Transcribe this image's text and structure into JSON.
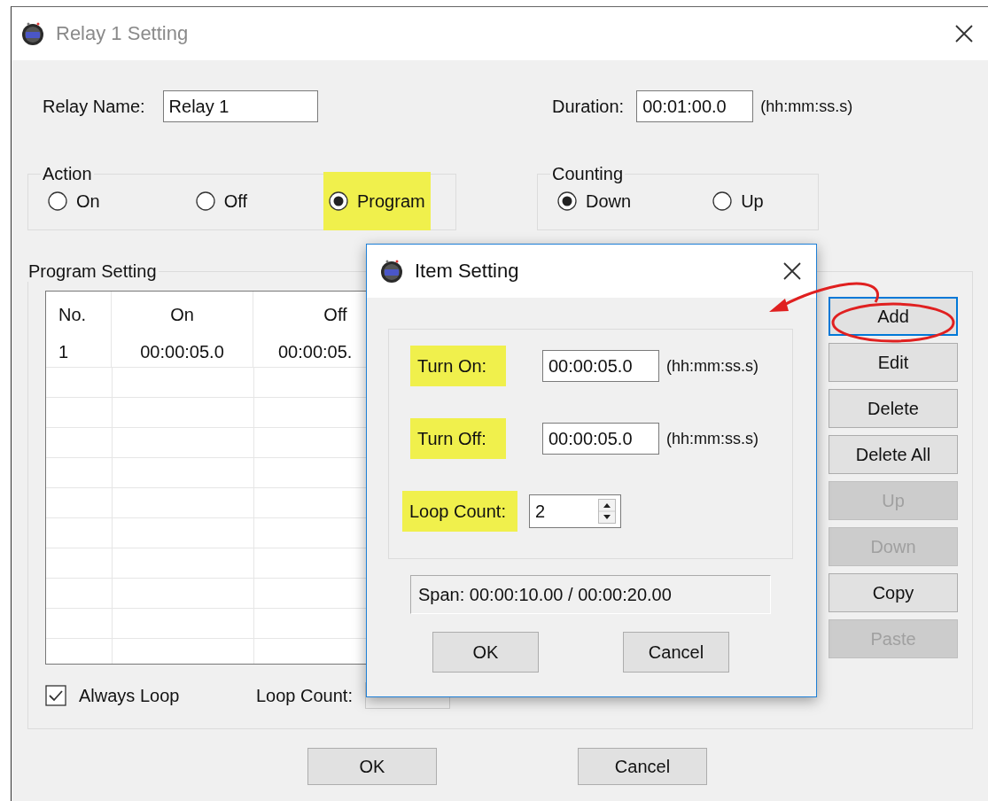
{
  "window": {
    "title": "Relay 1 Setting"
  },
  "relay_name": {
    "label": "Relay Name:",
    "value": "Relay 1"
  },
  "duration": {
    "label": "Duration:",
    "value": "00:01:00.0",
    "hint": "(hh:mm:ss.s)"
  },
  "action": {
    "title": "Action",
    "options": [
      {
        "label": "On",
        "selected": false,
        "highlighted": false
      },
      {
        "label": "Off",
        "selected": false,
        "highlighted": false
      },
      {
        "label": "Program",
        "selected": true,
        "highlighted": true
      }
    ]
  },
  "counting": {
    "title": "Counting",
    "options": [
      {
        "label": "Down",
        "selected": true
      },
      {
        "label": "Up",
        "selected": false
      }
    ]
  },
  "program_setting": {
    "title": "Program Setting",
    "table": {
      "columns": [
        "No.",
        "On",
        "Off"
      ],
      "rows": [
        [
          "1",
          "00:00:05.0",
          "00:00:05."
        ]
      ]
    },
    "buttons": [
      {
        "label": "Add",
        "disabled": false,
        "focused": true,
        "circled": true
      },
      {
        "label": "Edit",
        "disabled": false,
        "focused": false,
        "circled": false
      },
      {
        "label": "Delete",
        "disabled": false,
        "focused": false,
        "circled": false
      },
      {
        "label": "Delete All",
        "disabled": false,
        "focused": false,
        "circled": false
      },
      {
        "label": "Up",
        "disabled": true,
        "focused": false,
        "circled": false
      },
      {
        "label": "Down",
        "disabled": true,
        "focused": false,
        "circled": false
      },
      {
        "label": "Copy",
        "disabled": false,
        "focused": false,
        "circled": false
      },
      {
        "label": "Paste",
        "disabled": true,
        "focused": false,
        "circled": false
      }
    ],
    "always_loop": {
      "label": "Always Loop",
      "checked": true
    },
    "loop_count": {
      "label": "Loop Count:",
      "disabled": true
    }
  },
  "buttons": [
    {
      "label": "OK"
    },
    {
      "label": "Cancel"
    }
  ],
  "item_dialog": {
    "title": "Item Setting",
    "fields": [
      {
        "kind": "time",
        "label": "Turn On:",
        "value": "00:00:05.0",
        "hint": "(hh:mm:ss.s)",
        "highlighted": true
      },
      {
        "kind": "time",
        "label": "Turn Off:",
        "value": "00:00:05.0",
        "hint": "(hh:mm:ss.s)",
        "highlighted": true
      },
      {
        "kind": "spinner",
        "label": "Loop Count:",
        "value": "2",
        "highlighted": true
      }
    ],
    "span": "Span: 00:00:10.00 / 00:00:20.00",
    "buttons": [
      {
        "label": "OK"
      },
      {
        "label": "Cancel"
      }
    ]
  }
}
